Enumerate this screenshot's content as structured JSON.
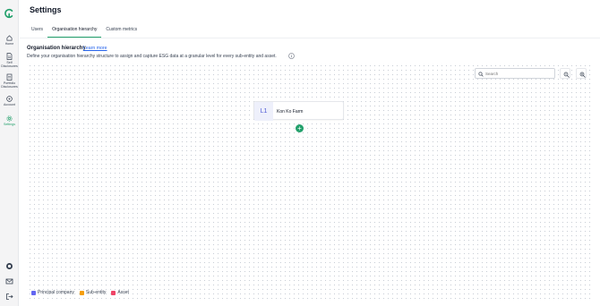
{
  "sidebar": {
    "items": [
      {
        "label": "Home",
        "icon": "home-icon"
      },
      {
        "label": "Self Disclosures",
        "icon": "document-icon"
      },
      {
        "label": "Portfolio Disclosures",
        "icon": "clipboard-icon"
      },
      {
        "label": "Account",
        "icon": "account-icon"
      },
      {
        "label": "Settings",
        "icon": "gear-icon"
      }
    ],
    "bottom_icons": [
      "help-icon",
      "mail-icon",
      "logout-icon"
    ],
    "active_color": "#22a06b"
  },
  "page": {
    "title": "Settings"
  },
  "tabs": [
    {
      "label": "Users"
    },
    {
      "label": "Organisation hierarchy"
    },
    {
      "label": "Custom metrics"
    }
  ],
  "section": {
    "title": "Organisation hierarchy",
    "learn_more": "Learn more",
    "description": "Define your organisation hierarchy structure to assign and capture ESG data at a granular level for every sub-entity and asset."
  },
  "search": {
    "placeholder": "Search"
  },
  "zoom": {
    "out_icon": "zoom-out-icon",
    "in_icon": "zoom-in-icon"
  },
  "node": {
    "level": "L1",
    "name": "Kon Ko Farm"
  },
  "add_button": {
    "label": "+"
  },
  "legend": [
    {
      "label": "Principal company",
      "color": "#6366f1"
    },
    {
      "label": "Sub-entity",
      "color": "#f59e0b"
    },
    {
      "label": "Asset",
      "color": "#ef4466"
    }
  ]
}
